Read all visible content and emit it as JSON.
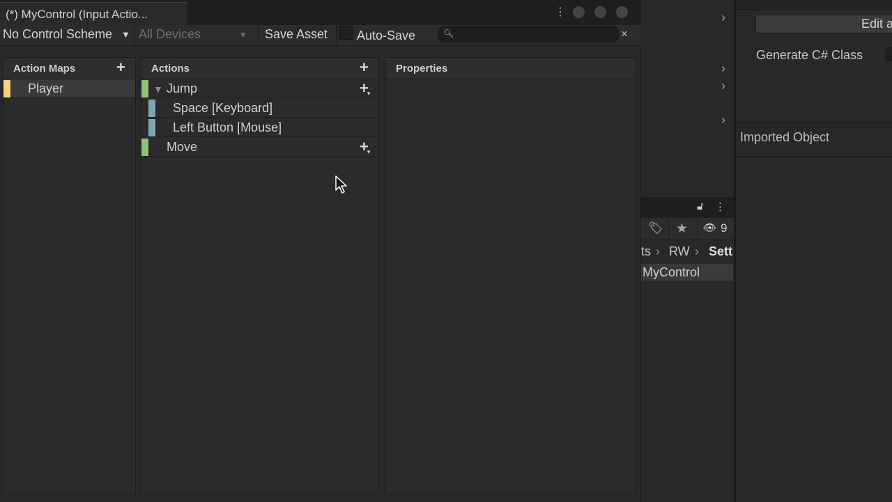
{
  "window": {
    "tab_title": "(*) MyControl (Input Actio...",
    "menu_icon": "⋮"
  },
  "toolbar": {
    "control_scheme": "No Control Scheme",
    "devices": "All Devices",
    "save_asset": "Save Asset",
    "auto_save": "Auto-Save",
    "search_placeholder": "",
    "search_clear": "×"
  },
  "action_maps": {
    "title": "Action Maps",
    "add": "+",
    "items": [
      {
        "label": "Player",
        "color": "#f2d57b",
        "selected": true
      }
    ]
  },
  "actions": {
    "title": "Actions",
    "add": "+",
    "items": [
      {
        "label": "Jump",
        "expanded": true,
        "color": "#8fc37c",
        "bindings": [
          {
            "label": "Space [Keyboard]",
            "color": "#7fa6b0"
          },
          {
            "label": "Left Button [Mouse]",
            "color": "#7fa6b0"
          }
        ]
      },
      {
        "label": "Move",
        "color": "#8fc37c",
        "bindings": []
      }
    ]
  },
  "properties": {
    "title": "Properties"
  },
  "inspector": {
    "edit_button": "Edit a",
    "generate_class": "Generate C# Class",
    "imported_object": "Imported Object"
  },
  "project": {
    "hidden_count": "9",
    "breadcrumb": [
      "ts",
      "RW",
      "Sett"
    ],
    "asset_name": "MyControl"
  },
  "colors": {
    "player_bar": "#f2d57b",
    "action_bar": "#8fc37c",
    "binding_bar": "#7fa6b0"
  }
}
